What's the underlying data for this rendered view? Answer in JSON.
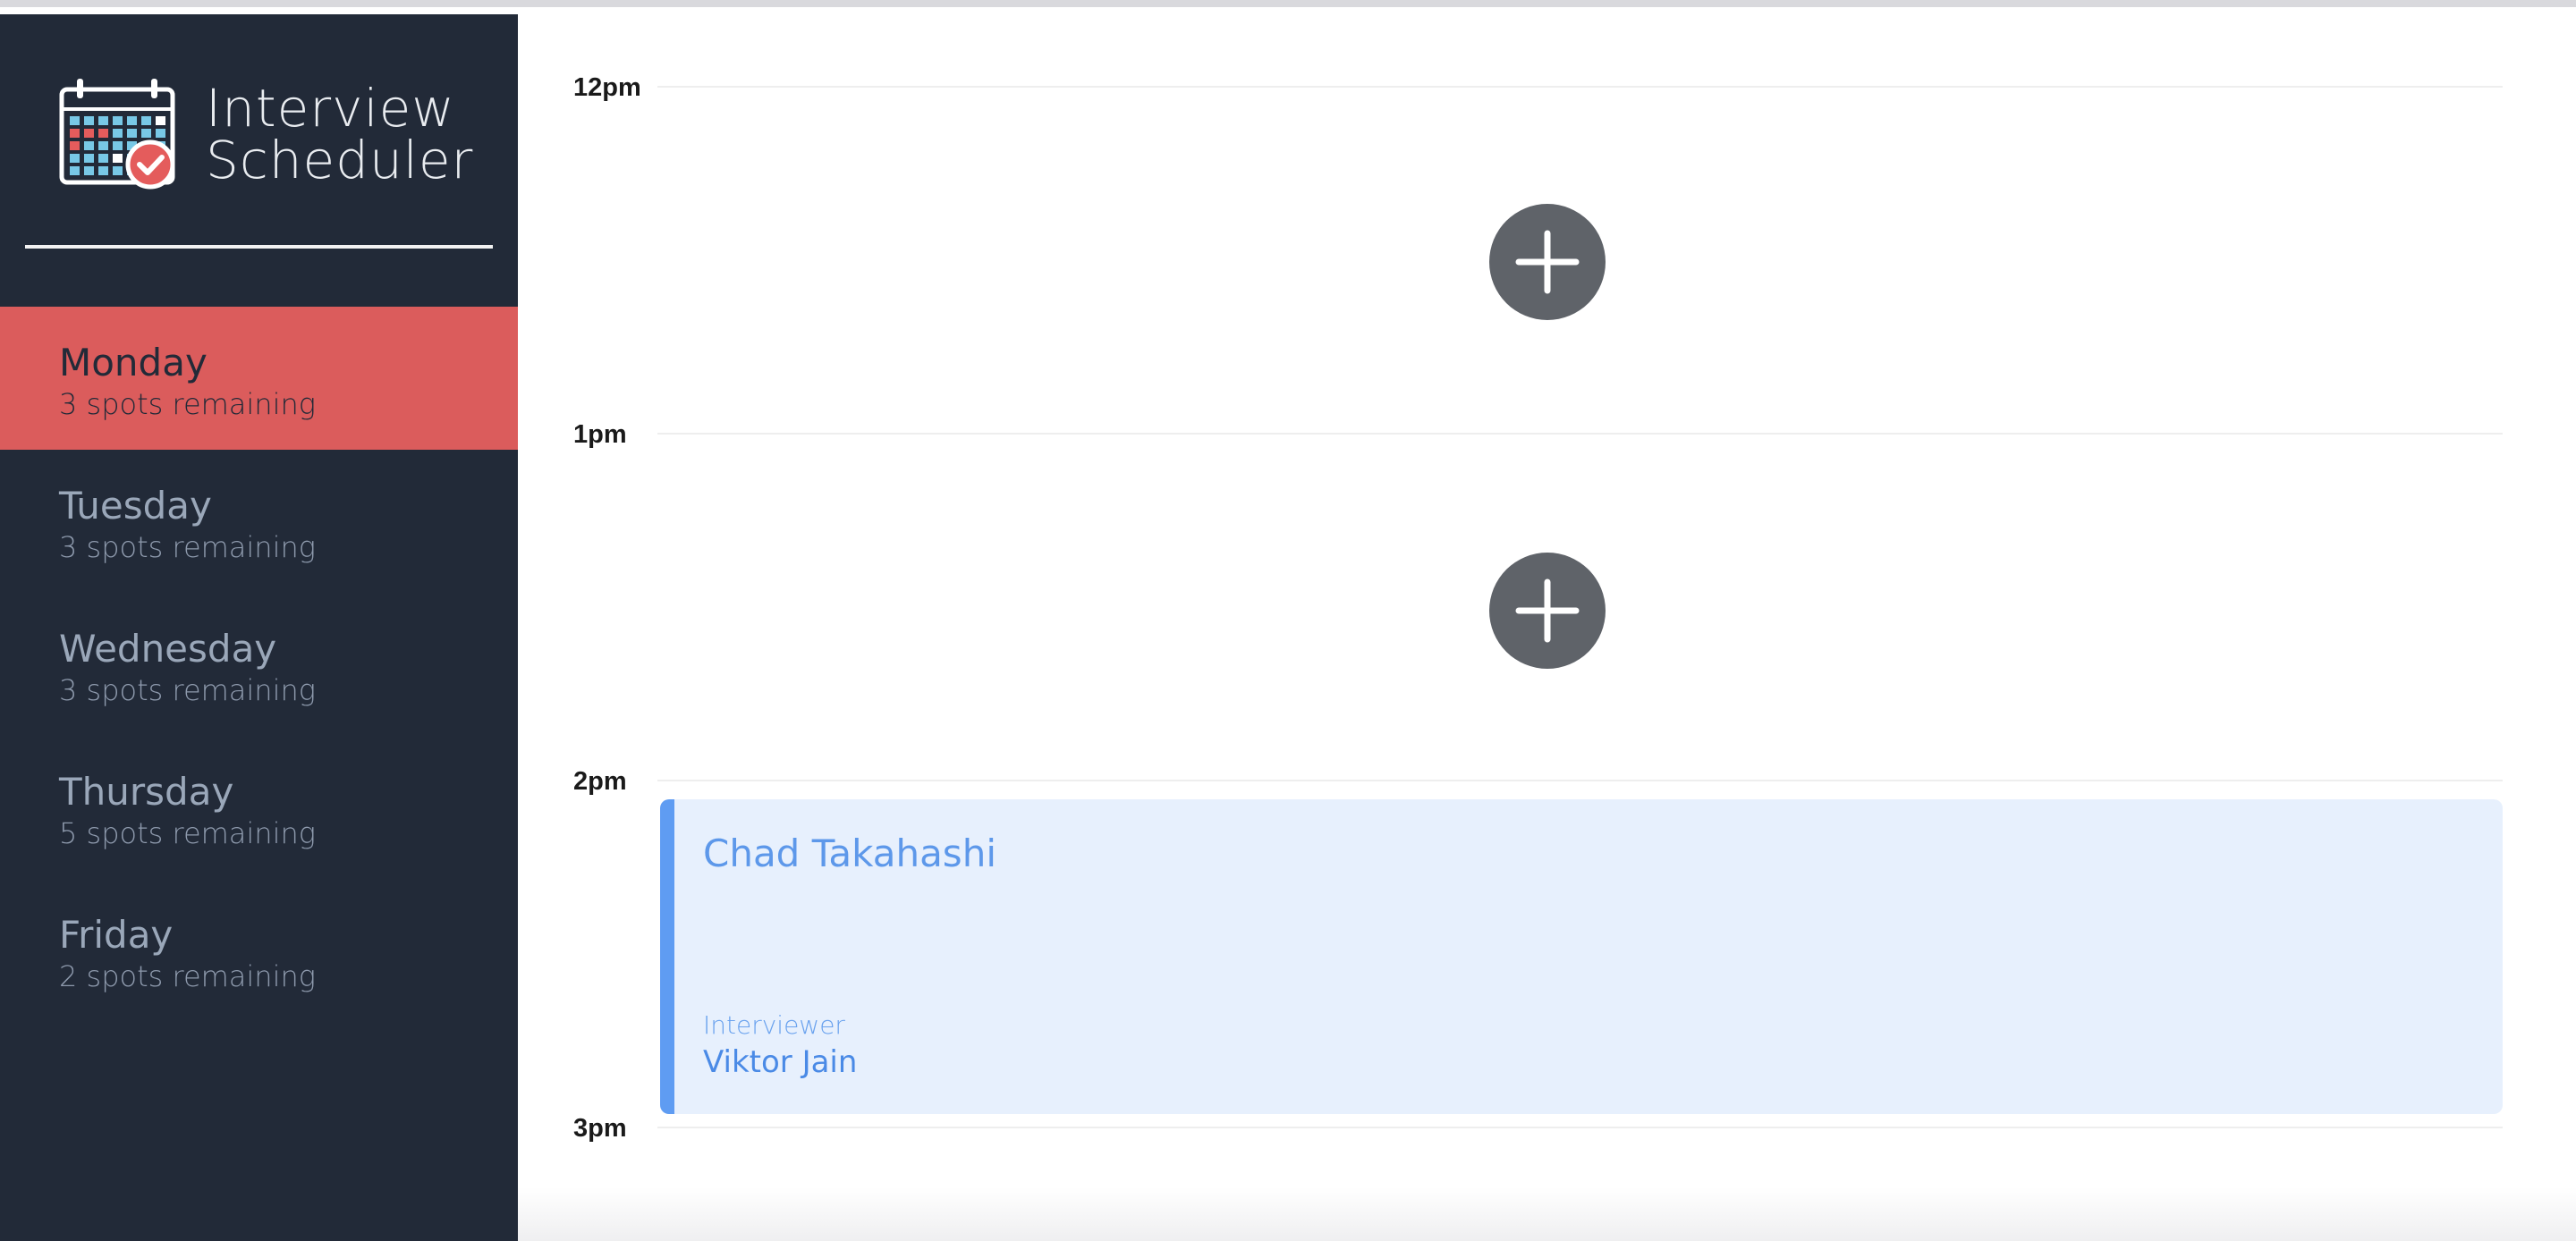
{
  "sidebar": {
    "brand_line1": "Interview",
    "brand_line2": "Scheduler",
    "logo_icon": "calendar-check-icon",
    "days": [
      {
        "name": "Monday",
        "spots": "3 spots remaining",
        "selected": true
      },
      {
        "name": "Tuesday",
        "spots": "3 spots remaining",
        "selected": false
      },
      {
        "name": "Wednesday",
        "spots": "3 spots remaining",
        "selected": false
      },
      {
        "name": "Thursday",
        "spots": "5 spots remaining",
        "selected": false
      },
      {
        "name": "Friday",
        "spots": "2 spots remaining",
        "selected": false
      }
    ]
  },
  "schedule": {
    "times": [
      "12pm",
      "1pm",
      "2pm",
      "3pm"
    ],
    "slots": [
      {
        "time": "12pm",
        "state": "empty",
        "icon": "plus-icon"
      },
      {
        "time": "1pm",
        "state": "empty",
        "icon": "plus-icon"
      },
      {
        "time": "2pm",
        "state": "booked",
        "student": "Chad Takahashi",
        "interviewer_label": "Interviewer",
        "interviewer": "Viktor Jain"
      }
    ]
  },
  "colors": {
    "sidebar_bg": "#222a38",
    "selected_day": "#db5c5c",
    "appointment_bg": "#e7f0fd",
    "appointment_accent": "#5f9cf2",
    "add_button": "#5f6369"
  }
}
